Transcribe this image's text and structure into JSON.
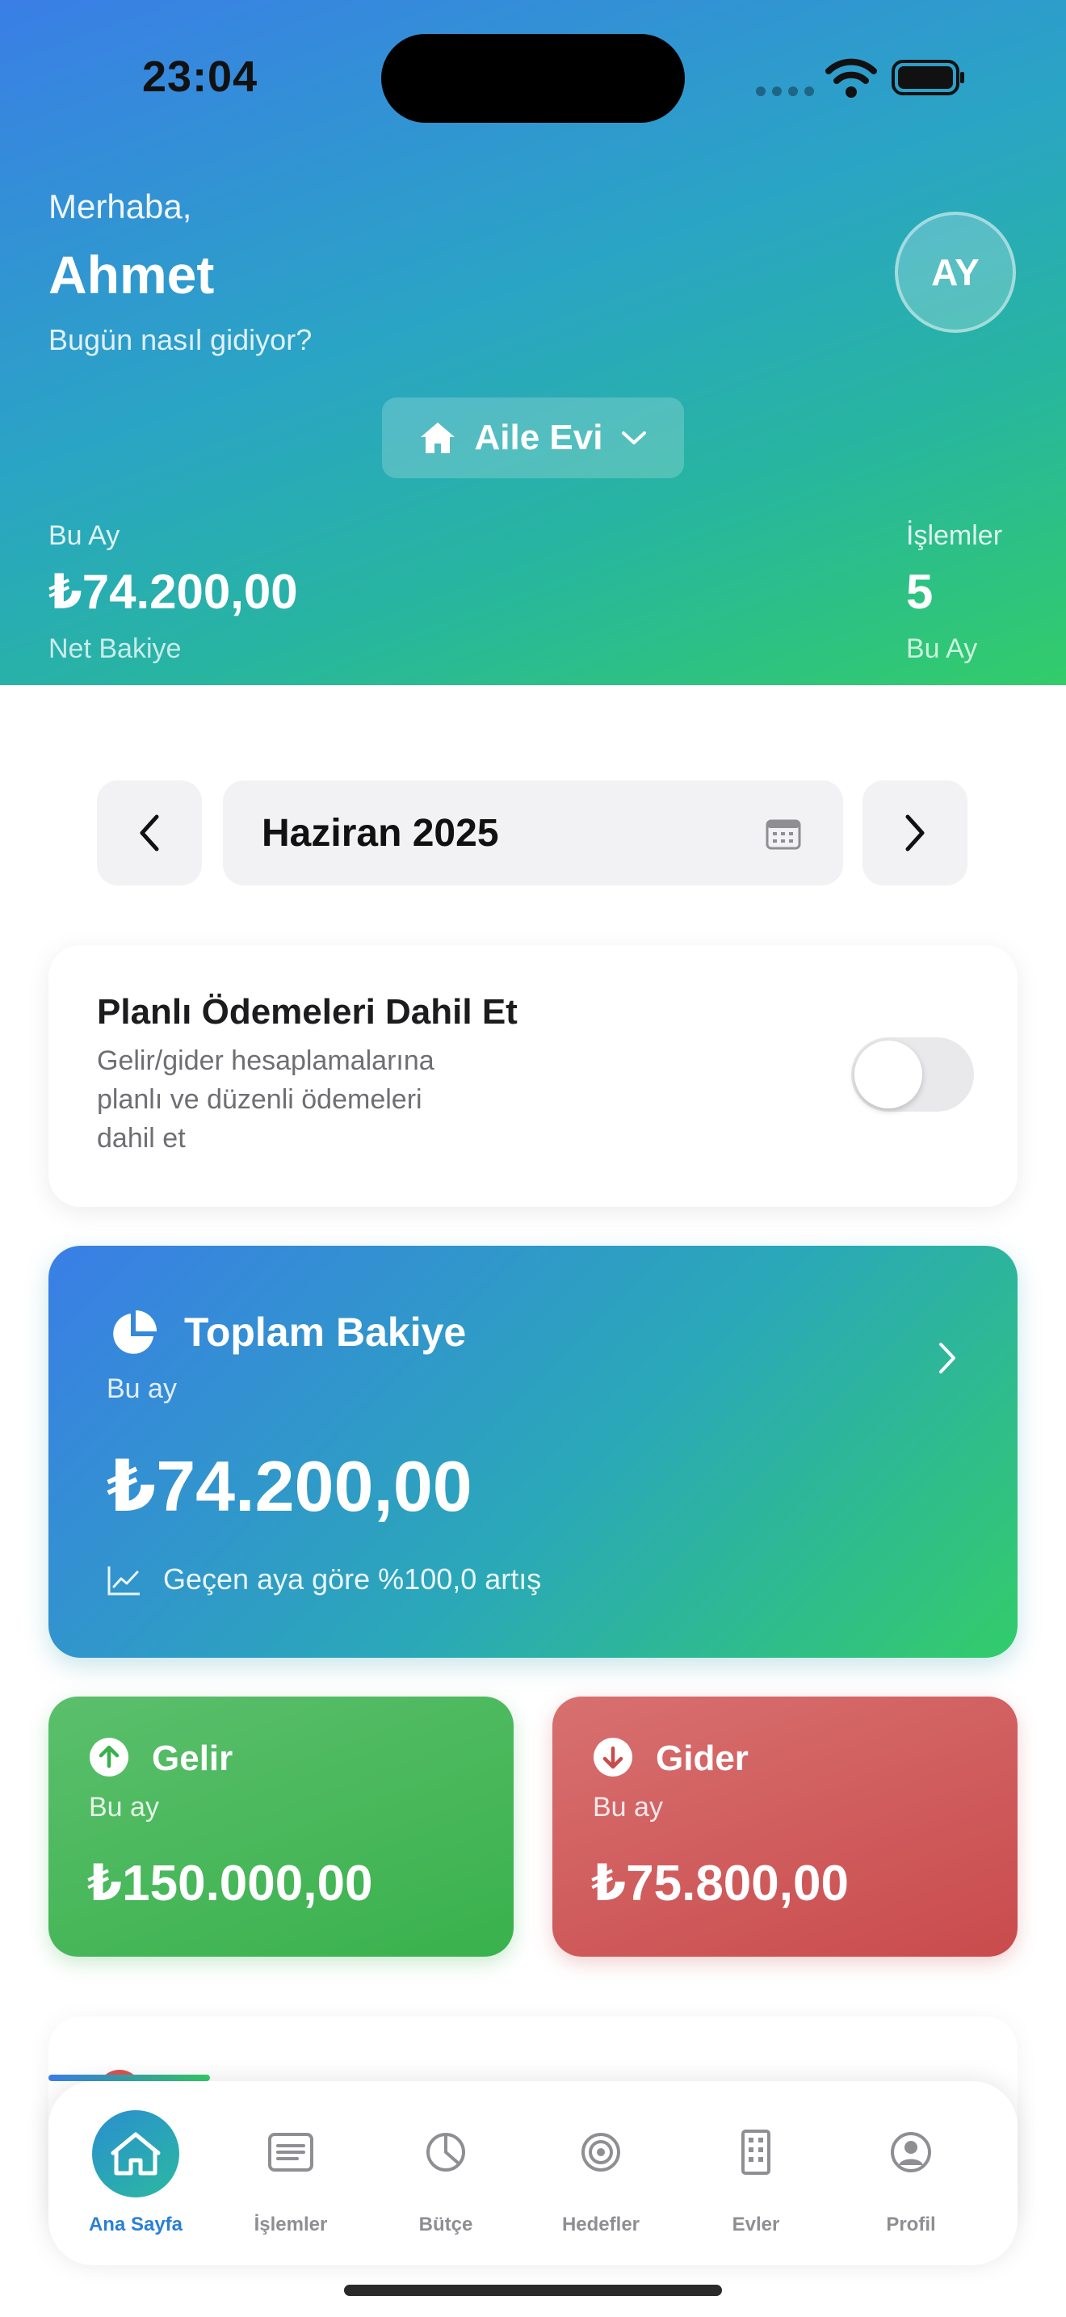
{
  "status": {
    "time": "23:04"
  },
  "header": {
    "greeting": "Merhaba,",
    "user_name": "Ahmet",
    "subtitle": "Bugün nasıl gidiyor?",
    "avatar_initials": "AY",
    "house_selector": "Aile Evi",
    "left_stat": {
      "label": "Bu Ay",
      "value": "₺74.200,00",
      "caption": "Net Bakiye"
    },
    "right_stat": {
      "label": "İşlemler",
      "value": "5",
      "caption": "Bu Ay"
    }
  },
  "month_nav": {
    "current": "Haziran 2025"
  },
  "planned_payments": {
    "title": "Planlı Ödemeleri Dahil Et",
    "description_lines": [
      "Gelir/gider hesaplamalarına",
      "planlı ve düzenli ödemeleri",
      "dahil et"
    ],
    "enabled": false
  },
  "total_balance": {
    "title": "Toplam Bakiye",
    "period": "Bu ay",
    "amount": "₺74.200,00",
    "trend_text": "Geçen aya göre %100,0 artış"
  },
  "income": {
    "title": "Gelir",
    "period": "Bu ay",
    "amount": "₺150.000,00"
  },
  "expense": {
    "title": "Gider",
    "period": "Bu ay",
    "amount": "₺75.800,00"
  },
  "tabs": [
    {
      "label": "Ana Sayfa",
      "icon": "home-icon",
      "active": true
    },
    {
      "label": "İşlemler",
      "icon": "list-icon",
      "active": false
    },
    {
      "label": "Bütçe",
      "icon": "pie-chart-icon",
      "active": false
    },
    {
      "label": "Hedefler",
      "icon": "target-icon",
      "active": false
    },
    {
      "label": "Evler",
      "icon": "building-icon",
      "active": false
    },
    {
      "label": "Profil",
      "icon": "person-icon",
      "active": false
    }
  ],
  "colors": {
    "header_gradient_start": "#3a7ee6",
    "header_gradient_end": "#33cc6a",
    "income_green": "#39b14c",
    "expense_red": "#c94b4c",
    "active_tab_blue": "#2a7fd6"
  }
}
